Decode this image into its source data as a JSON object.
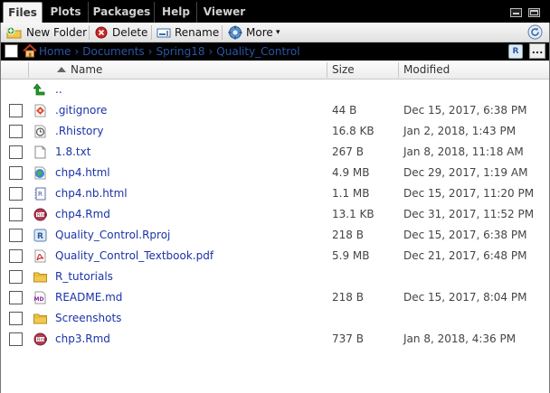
{
  "tabs": [
    {
      "label": "Files",
      "active": true
    },
    {
      "label": "Plots",
      "active": false
    },
    {
      "label": "Packages",
      "active": false
    },
    {
      "label": "Help",
      "active": false
    },
    {
      "label": "Viewer",
      "active": false
    }
  ],
  "toolbar": {
    "new_folder": "New Folder",
    "delete": "Delete",
    "rename": "Rename",
    "more": "More",
    "more_caret": "▾"
  },
  "breadcrumb": {
    "items": [
      "Home",
      "Documents",
      "Spring18",
      "Quality_Control"
    ],
    "separator": "›",
    "project_badge": "R",
    "more_label": "..."
  },
  "columns": {
    "name": "Name",
    "size": "Size",
    "modified": "Modified"
  },
  "files": [
    {
      "name": "..",
      "size": "",
      "modified": "",
      "icon": "up-arrow-icon",
      "checkbox": false
    },
    {
      "name": ".gitignore",
      "size": "44 B",
      "modified": "Dec 15, 2017, 6:38 PM",
      "icon": "git-file-icon",
      "checkbox": true
    },
    {
      "name": ".Rhistory",
      "size": "16.8 KB",
      "modified": "Jan 2, 2018, 1:43 PM",
      "icon": "history-file-icon",
      "checkbox": true
    },
    {
      "name": "1.8.txt",
      "size": "267 B",
      "modified": "Jan 8, 2018, 11:18 AM",
      "icon": "text-file-icon",
      "checkbox": true
    },
    {
      "name": "chp4.html",
      "size": "4.9 MB",
      "modified": "Dec 29, 2017, 1:19 AM",
      "icon": "html-file-icon",
      "checkbox": true
    },
    {
      "name": "chp4.nb.html",
      "size": "1.1 MB",
      "modified": "Dec 15, 2017, 11:20 PM",
      "icon": "notebook-file-icon",
      "checkbox": true
    },
    {
      "name": "chp4.Rmd",
      "size": "13.1 KB",
      "modified": "Dec 31, 2017, 11:52 PM",
      "icon": "rmd-file-icon",
      "checkbox": true
    },
    {
      "name": "Quality_Control.Rproj",
      "size": "218 B",
      "modified": "Dec 15, 2017, 6:38 PM",
      "icon": "rproj-file-icon",
      "checkbox": true
    },
    {
      "name": "Quality_Control_Textbook.pdf",
      "size": "5.9 MB",
      "modified": "Dec 21, 2017, 6:48 PM",
      "icon": "pdf-file-icon",
      "checkbox": true
    },
    {
      "name": "R_tutorials",
      "size": "",
      "modified": "",
      "icon": "folder-icon",
      "checkbox": true
    },
    {
      "name": "README.md",
      "size": "218 B",
      "modified": "Dec 15, 2017, 8:04 PM",
      "icon": "markdown-file-icon",
      "checkbox": true
    },
    {
      "name": "Screenshots",
      "size": "",
      "modified": "",
      "icon": "folder-icon",
      "checkbox": true
    },
    {
      "name": "chp3.Rmd",
      "size": "737 B",
      "modified": "Jan 8, 2018, 4:36 PM",
      "icon": "rmd-file-icon",
      "checkbox": true
    }
  ],
  "colors": {
    "link": "#1a33a8",
    "breadcrumb": "#2b56a6",
    "folder": "#f2c94c",
    "green_arrow": "#1f9a2a"
  }
}
